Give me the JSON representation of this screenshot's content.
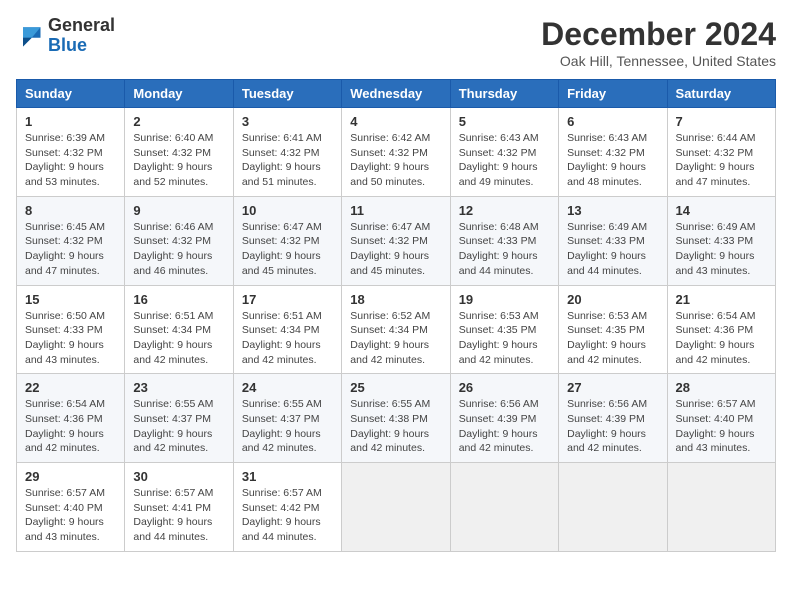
{
  "logo": {
    "text_general": "General",
    "text_blue": "Blue"
  },
  "header": {
    "month_year": "December 2024",
    "location": "Oak Hill, Tennessee, United States"
  },
  "days_of_week": [
    "Sunday",
    "Monday",
    "Tuesday",
    "Wednesday",
    "Thursday",
    "Friday",
    "Saturday"
  ],
  "weeks": [
    [
      {
        "day": "1",
        "sunrise": "6:39 AM",
        "sunset": "4:32 PM",
        "daylight": "9 hours and 53 minutes."
      },
      {
        "day": "2",
        "sunrise": "6:40 AM",
        "sunset": "4:32 PM",
        "daylight": "9 hours and 52 minutes."
      },
      {
        "day": "3",
        "sunrise": "6:41 AM",
        "sunset": "4:32 PM",
        "daylight": "9 hours and 51 minutes."
      },
      {
        "day": "4",
        "sunrise": "6:42 AM",
        "sunset": "4:32 PM",
        "daylight": "9 hours and 50 minutes."
      },
      {
        "day": "5",
        "sunrise": "6:43 AM",
        "sunset": "4:32 PM",
        "daylight": "9 hours and 49 minutes."
      },
      {
        "day": "6",
        "sunrise": "6:43 AM",
        "sunset": "4:32 PM",
        "daylight": "9 hours and 48 minutes."
      },
      {
        "day": "7",
        "sunrise": "6:44 AM",
        "sunset": "4:32 PM",
        "daylight": "9 hours and 47 minutes."
      }
    ],
    [
      {
        "day": "8",
        "sunrise": "6:45 AM",
        "sunset": "4:32 PM",
        "daylight": "9 hours and 47 minutes."
      },
      {
        "day": "9",
        "sunrise": "6:46 AM",
        "sunset": "4:32 PM",
        "daylight": "9 hours and 46 minutes."
      },
      {
        "day": "10",
        "sunrise": "6:47 AM",
        "sunset": "4:32 PM",
        "daylight": "9 hours and 45 minutes."
      },
      {
        "day": "11",
        "sunrise": "6:47 AM",
        "sunset": "4:32 PM",
        "daylight": "9 hours and 45 minutes."
      },
      {
        "day": "12",
        "sunrise": "6:48 AM",
        "sunset": "4:33 PM",
        "daylight": "9 hours and 44 minutes."
      },
      {
        "day": "13",
        "sunrise": "6:49 AM",
        "sunset": "4:33 PM",
        "daylight": "9 hours and 44 minutes."
      },
      {
        "day": "14",
        "sunrise": "6:49 AM",
        "sunset": "4:33 PM",
        "daylight": "9 hours and 43 minutes."
      }
    ],
    [
      {
        "day": "15",
        "sunrise": "6:50 AM",
        "sunset": "4:33 PM",
        "daylight": "9 hours and 43 minutes."
      },
      {
        "day": "16",
        "sunrise": "6:51 AM",
        "sunset": "4:34 PM",
        "daylight": "9 hours and 42 minutes."
      },
      {
        "day": "17",
        "sunrise": "6:51 AM",
        "sunset": "4:34 PM",
        "daylight": "9 hours and 42 minutes."
      },
      {
        "day": "18",
        "sunrise": "6:52 AM",
        "sunset": "4:34 PM",
        "daylight": "9 hours and 42 minutes."
      },
      {
        "day": "19",
        "sunrise": "6:53 AM",
        "sunset": "4:35 PM",
        "daylight": "9 hours and 42 minutes."
      },
      {
        "day": "20",
        "sunrise": "6:53 AM",
        "sunset": "4:35 PM",
        "daylight": "9 hours and 42 minutes."
      },
      {
        "day": "21",
        "sunrise": "6:54 AM",
        "sunset": "4:36 PM",
        "daylight": "9 hours and 42 minutes."
      }
    ],
    [
      {
        "day": "22",
        "sunrise": "6:54 AM",
        "sunset": "4:36 PM",
        "daylight": "9 hours and 42 minutes."
      },
      {
        "day": "23",
        "sunrise": "6:55 AM",
        "sunset": "4:37 PM",
        "daylight": "9 hours and 42 minutes."
      },
      {
        "day": "24",
        "sunrise": "6:55 AM",
        "sunset": "4:37 PM",
        "daylight": "9 hours and 42 minutes."
      },
      {
        "day": "25",
        "sunrise": "6:55 AM",
        "sunset": "4:38 PM",
        "daylight": "9 hours and 42 minutes."
      },
      {
        "day": "26",
        "sunrise": "6:56 AM",
        "sunset": "4:39 PM",
        "daylight": "9 hours and 42 minutes."
      },
      {
        "day": "27",
        "sunrise": "6:56 AM",
        "sunset": "4:39 PM",
        "daylight": "9 hours and 42 minutes."
      },
      {
        "day": "28",
        "sunrise": "6:57 AM",
        "sunset": "4:40 PM",
        "daylight": "9 hours and 43 minutes."
      }
    ],
    [
      {
        "day": "29",
        "sunrise": "6:57 AM",
        "sunset": "4:40 PM",
        "daylight": "9 hours and 43 minutes."
      },
      {
        "day": "30",
        "sunrise": "6:57 AM",
        "sunset": "4:41 PM",
        "daylight": "9 hours and 44 minutes."
      },
      {
        "day": "31",
        "sunrise": "6:57 AM",
        "sunset": "4:42 PM",
        "daylight": "9 hours and 44 minutes."
      },
      null,
      null,
      null,
      null
    ]
  ],
  "labels": {
    "sunrise": "Sunrise:",
    "sunset": "Sunset:",
    "daylight": "Daylight:"
  }
}
